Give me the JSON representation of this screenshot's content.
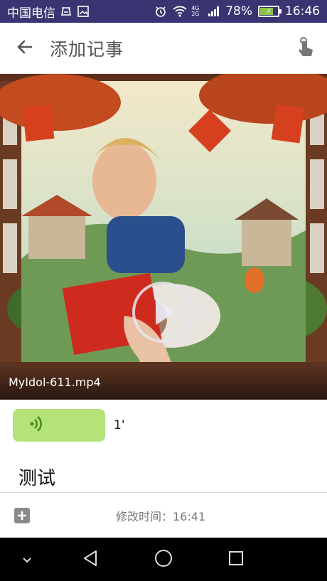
{
  "status_bar": {
    "carrier": "中国电信",
    "network": "4G 2G",
    "battery": "78%",
    "time": "16:46",
    "icons": [
      "sim-icon",
      "image-icon",
      "alarm-icon",
      "wifi-icon",
      "signal-icon",
      "battery-icon"
    ]
  },
  "app_bar": {
    "title": "添加记事",
    "icons": [
      "back-arrow-icon",
      "touch-gesture-icon"
    ]
  },
  "video": {
    "filename": "MyIdol-611.mp4",
    "icon": "play-icon"
  },
  "audio": {
    "duration": "1'",
    "icon": "sound-wave-icon",
    "color": "#b6e27a"
  },
  "note": {
    "text": "测试"
  },
  "footer": {
    "modified_time": "修改时间：16:41",
    "icon": "add-icon"
  },
  "nav_bar": {
    "icons": [
      "collapse-chevron-icon",
      "back-icon",
      "home-icon",
      "recents-icon"
    ]
  },
  "colors": {
    "status_bar": "#3a3572",
    "accent_audio": "#b6e27a"
  }
}
